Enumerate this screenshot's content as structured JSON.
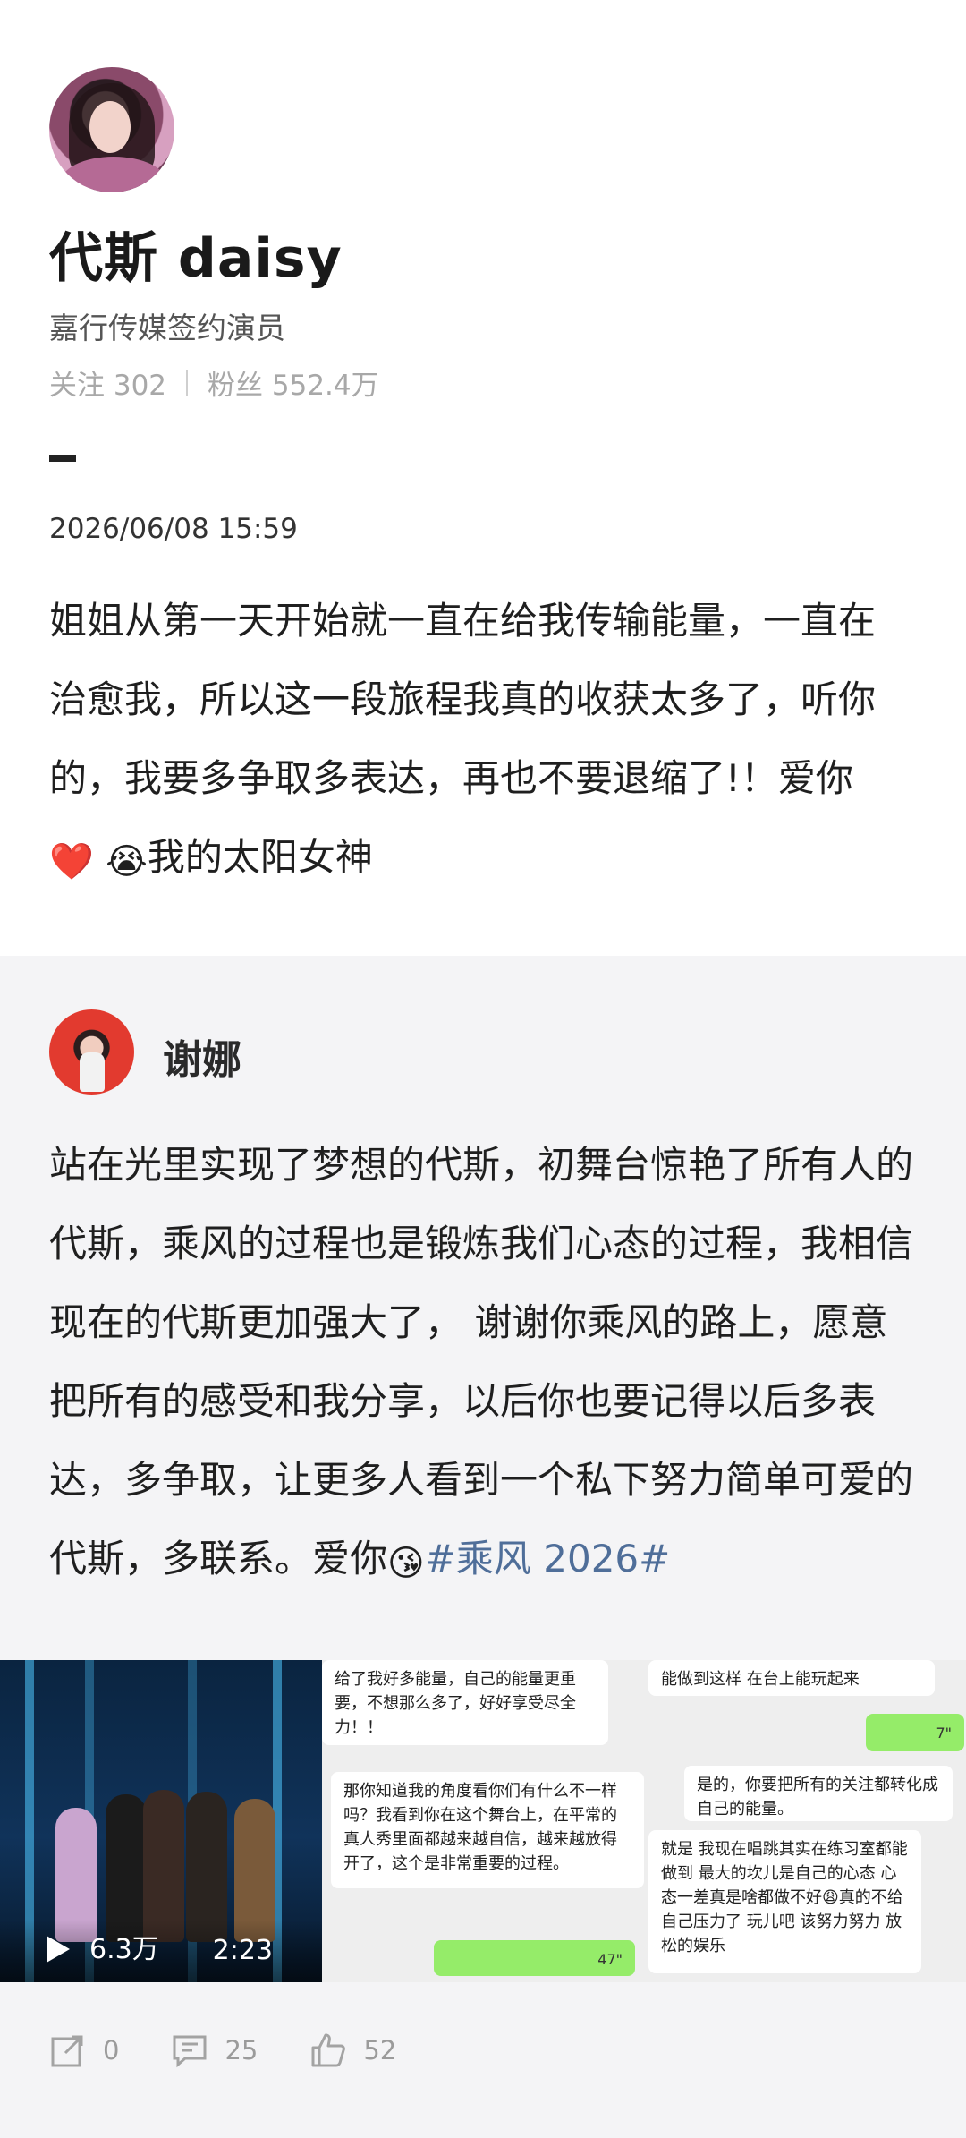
{
  "profile": {
    "name": "代斯 daisy",
    "bio": "嘉行传媒签约演员",
    "following_label": "关注 302",
    "followers_label": "粉丝 552.4万"
  },
  "post": {
    "date": "2026/06/08 15:59",
    "text": "姐姐从第一天开始就一直在给我传输能量，一直在治愈我，所以这一段旅程我真的收获太多了，听你的，我要多争取多表达，再也不要退缩了!！爱你",
    "tail": "我的太阳女神"
  },
  "quoted": {
    "author": "谢娜",
    "text": "站在光里实现了梦想的代斯，初舞台惊艳了所有人的代斯，乘风的过程也是锻炼我们心态的过程，我相信现在的代斯更加强大了， 谢谢你乘风的路上，愿意把所有的感受和我分享，以后你也要记得以后多表达，多争取，让更多人看到一个私下努力简单可爱的代斯，多联系。爱你",
    "hashtag": "#乘风 2026#"
  },
  "media": {
    "video_views": "6.3万",
    "video_duration": "2:23",
    "chat": {
      "left_top": "给了我好多能量，自己的能量更重要，不想那么多了，好好享受尽全力！！",
      "left_mid": "那你知道我的角度看你们有什么不一样吗？我看到你在这个舞台上，在平常的真人秀里面都越来越自信，越来越放得开了，这个是非常重要的过程。",
      "green_left": "47\"",
      "right_top": "能做到这样 在台上能玩起来",
      "green_right": "7\"",
      "right_mid": "是的，你要把所有的关注都转化成自己的能量。",
      "right_bottom": "就是 我现在唱跳其实在练习室都能做到 最大的坎儿是自己的心态 心态一差真是啥都做不好😩真的不给自己压力了 玩儿吧 该努力努力 放松的娱乐"
    }
  },
  "actions": {
    "share": "0",
    "comment": "25",
    "like": "52"
  },
  "icons": [
    "share-icon",
    "comment-icon",
    "like-icon",
    "play-icon",
    "heart-emoji-icon",
    "crying-emoji-icon",
    "kiss-emoji-icon"
  ]
}
